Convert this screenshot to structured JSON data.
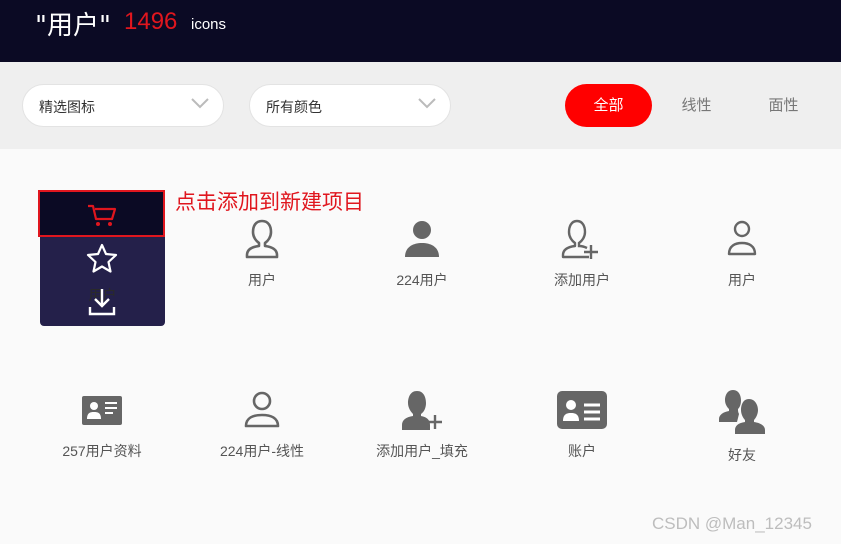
{
  "header": {
    "query": "\"用户\"",
    "count": "1496",
    "unit": "icons"
  },
  "filters": {
    "select_icons": "精选图标",
    "select_colors": "所有颜色",
    "tabs": [
      "全部",
      "线性",
      "面性"
    ]
  },
  "hover": {
    "tooltip": "点击添加到新建项目",
    "hidden_label": "用户"
  },
  "icons": [
    {
      "label": "用户",
      "icon": "user-outline-icon"
    },
    {
      "label": "224用户",
      "icon": "user-filled-icon"
    },
    {
      "label": "添加用户",
      "icon": "add-user-outline-icon"
    },
    {
      "label": "用户",
      "icon": "user-thin-icon"
    },
    {
      "label": "257用户资料",
      "icon": "id-card-icon"
    },
    {
      "label": "224用户-线性",
      "icon": "user-line-icon"
    },
    {
      "label": "添加用户_填充",
      "icon": "add-user-filled-icon"
    },
    {
      "label": "账户",
      "icon": "account-card-icon"
    },
    {
      "label": "好友",
      "icon": "friends-icon"
    }
  ],
  "watermark": "CSDN @Man_12345",
  "colors": {
    "header_bg": "#0b0a24",
    "accent": "#e0161e",
    "card_bg": "#24204a",
    "icon_gray": "#666666"
  }
}
